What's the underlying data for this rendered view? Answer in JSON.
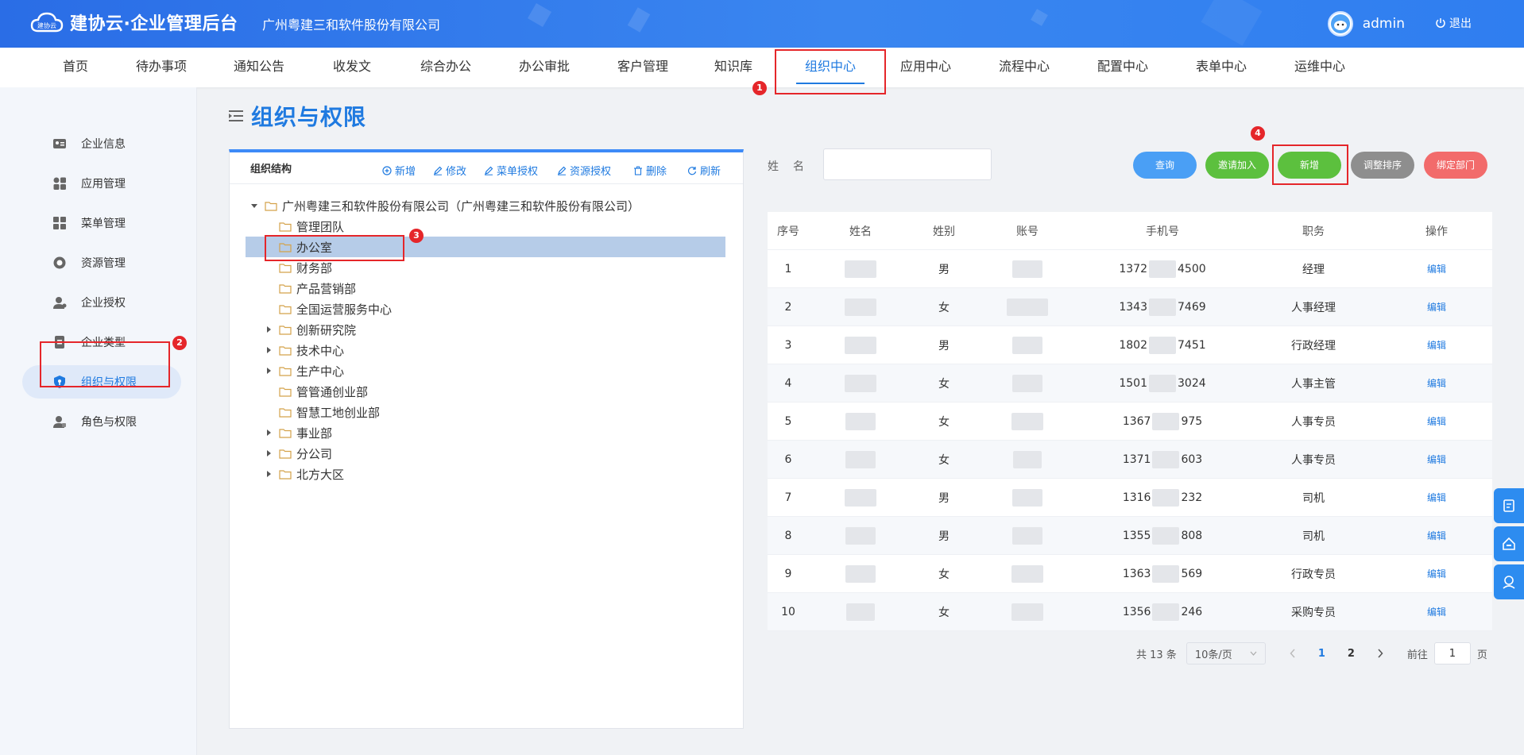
{
  "header": {
    "logo_text": "建协云",
    "app_title": "建协云·企业管理后台",
    "company": "广州粤建三和软件股份有限公司",
    "username": "admin",
    "logout_label": "退出"
  },
  "topnav": {
    "items": [
      "首页",
      "待办事项",
      "通知公告",
      "收发文",
      "综合办公",
      "办公审批",
      "客户管理",
      "知识库",
      "组织中心",
      "应用中心",
      "流程中心",
      "配置中心",
      "表单中心",
      "运维中心"
    ],
    "active": "组织中心"
  },
  "sidebar": {
    "items": [
      {
        "label": "企业信息",
        "icon": "id-card-icon"
      },
      {
        "label": "应用管理",
        "icon": "apps-grid-icon"
      },
      {
        "label": "菜单管理",
        "icon": "menu-grid-icon"
      },
      {
        "label": "资源管理",
        "icon": "resource-icon"
      },
      {
        "label": "企业授权",
        "icon": "user-auth-icon"
      },
      {
        "label": "企业类型",
        "icon": "document-icon"
      },
      {
        "label": "组织与权限",
        "icon": "shield-icon"
      },
      {
        "label": "角色与权限",
        "icon": "role-icon"
      }
    ],
    "active": "组织与权限"
  },
  "page": {
    "title": "组织与权限"
  },
  "tree": {
    "panel_title": "组织结构",
    "tools": [
      "新增",
      "修改",
      "菜单授权",
      "资源授权",
      "删除",
      "刷新"
    ],
    "root": "广州粤建三和软件股份有限公司（广州粤建三和软件股份有限公司）",
    "nodes": [
      "管理团队",
      "办公室",
      "财务部",
      "产品营销部",
      "全国运营服务中心",
      "创新研究院",
      "技术中心",
      "生产中心",
      "管管通创业部",
      "智慧工地创业部",
      "事业部",
      "分公司",
      "北方大区"
    ],
    "selected": "办公室"
  },
  "search": {
    "label": "姓名",
    "value": ""
  },
  "buttons": {
    "query": "查询",
    "invite": "邀请加入",
    "add": "新增",
    "sort": "调整排序",
    "bind": "绑定部门",
    "colors": {
      "query": "#4a9ff5",
      "invite": "#5cc03e",
      "add": "#5cc03e",
      "sort": "#8e8e8e",
      "bind": "#f26b6b"
    }
  },
  "table": {
    "headers": [
      "序号",
      "姓名",
      "姓别",
      "账号",
      "手机号",
      "职务",
      "操作"
    ],
    "rows": [
      {
        "idx": "1",
        "gender": "男",
        "phone_a": "1372",
        "phone_b": "4500",
        "duty": "经理",
        "op": "编辑"
      },
      {
        "idx": "2",
        "gender": "女",
        "phone_a": "1343",
        "phone_b": "7469",
        "duty": "人事经理",
        "op": "编辑"
      },
      {
        "idx": "3",
        "gender": "男",
        "phone_a": "1802",
        "phone_b": "7451",
        "duty": "行政经理",
        "op": "编辑"
      },
      {
        "idx": "4",
        "gender": "女",
        "phone_a": "1501",
        "phone_b": "3024",
        "duty": "人事主管",
        "op": "编辑"
      },
      {
        "idx": "5",
        "gender": "女",
        "phone_a": "1367",
        "phone_b": "975",
        "duty": "人事专员",
        "op": "编辑"
      },
      {
        "idx": "6",
        "gender": "女",
        "phone_a": "1371",
        "phone_b": "603",
        "duty": "人事专员",
        "op": "编辑"
      },
      {
        "idx": "7",
        "gender": "男",
        "phone_a": "1316",
        "phone_b": "232",
        "duty": "司机",
        "op": "编辑"
      },
      {
        "idx": "8",
        "gender": "男",
        "phone_a": "1355",
        "phone_b": "808",
        "duty": "司机",
        "op": "编辑"
      },
      {
        "idx": "9",
        "gender": "女",
        "phone_a": "1363",
        "phone_b": "569",
        "duty": "行政专员",
        "op": "编辑"
      },
      {
        "idx": "10",
        "gender": "女",
        "phone_a": "1356",
        "phone_b": "246",
        "duty": "采购专员",
        "op": "编辑"
      }
    ]
  },
  "pager": {
    "total": "共 13 条",
    "page_size": "10条/页",
    "pages": [
      "1",
      "2"
    ],
    "current": "1",
    "goto_label": "前往",
    "goto_value": "1",
    "goto_unit": "页"
  },
  "annotations": [
    "1",
    "2",
    "3",
    "4"
  ]
}
